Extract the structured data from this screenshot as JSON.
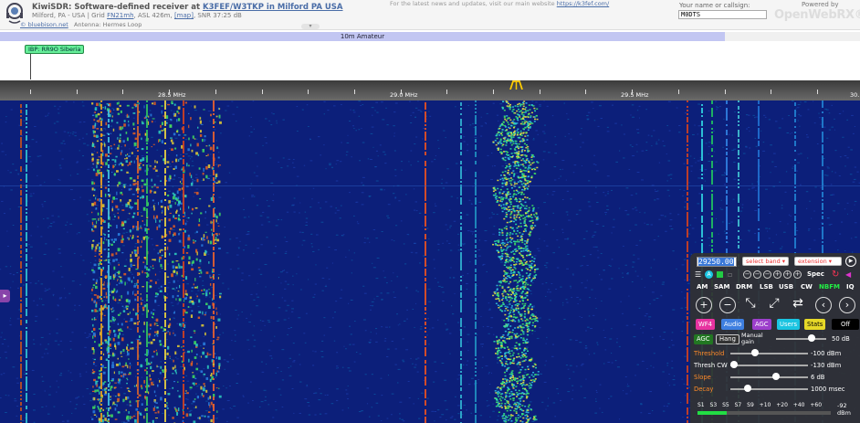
{
  "header": {
    "title_prefix": "KiwiSDR: Software-defined receiver at ",
    "title_owner": "K3FEF/W3TKP in Milford PA USA",
    "location": "Milford, PA - USA | Grid ",
    "grid": "FN21mh",
    "location_suffix": ", ASL 426m, ",
    "map_link": "[map]",
    "snr": ", SNR 37:25 dB",
    "credit_link": "© bluebison.net",
    "antenna": "Antenna: Hermes Loop",
    "news_text": "For the latest news and updates, visit our main website ",
    "news_link": "https://k3fef.com/",
    "callsign_label": "Your name or callsign:",
    "callsign_value": "M0DTS",
    "powered_by": "Powered by",
    "brand": "OpenWebRX®"
  },
  "band_bar": {
    "band_name": "10m Amateur",
    "beacon_label": "IBP: RR9O Siberia"
  },
  "scale": {
    "labels": [
      "28.5 MHz",
      "29.0 MHz",
      "29.5 MHz",
      "30."
    ]
  },
  "panel": {
    "frequency": "29250.00",
    "band_select": "select band",
    "ext_select": "extension",
    "row2": {
      "spec": "Spec"
    },
    "modes": [
      "AM",
      "SAM",
      "DRM",
      "LSB",
      "USB",
      "CW",
      "NBFM",
      "IQ"
    ],
    "active_mode": "NBFM",
    "tabs": {
      "wf": "WF4",
      "audio": "Audio",
      "agc": "AGC",
      "users": "Users",
      "stats": "Stats",
      "off": "Off"
    },
    "agc": {
      "agc_label": "AGC",
      "hang_label": "Hang",
      "manual_gain_line1": "Manual",
      "manual_gain_line2": "gain",
      "gain_value": "50 dB",
      "gain_level": 0.75
    },
    "sliders": [
      {
        "label": "Threshold",
        "value": "-100 dBm",
        "level": 0.3,
        "color": "#ff8c2a"
      },
      {
        "label": "Thresh CW",
        "value": "-130 dBm",
        "level": 0.0,
        "color": "#ffffff"
      },
      {
        "label": "Slope",
        "value": "6 dB",
        "level": 0.6,
        "color": "#ff8c2a"
      },
      {
        "label": "Decay",
        "value": "1000 msec",
        "level": 0.2,
        "color": "#ff8c2a"
      }
    ],
    "smeter": {
      "scale": "S1 S3 S5 S7 S9 +10 +20 +40 +60",
      "value": "-92",
      "unit": "dBm",
      "level": 0.22
    }
  },
  "colors": {
    "waterfall_bg": "#0a1a6e",
    "band_amateur": "#c2c6f2",
    "mode_active": "#22ee44",
    "freq_selected": "#3a78d8"
  }
}
